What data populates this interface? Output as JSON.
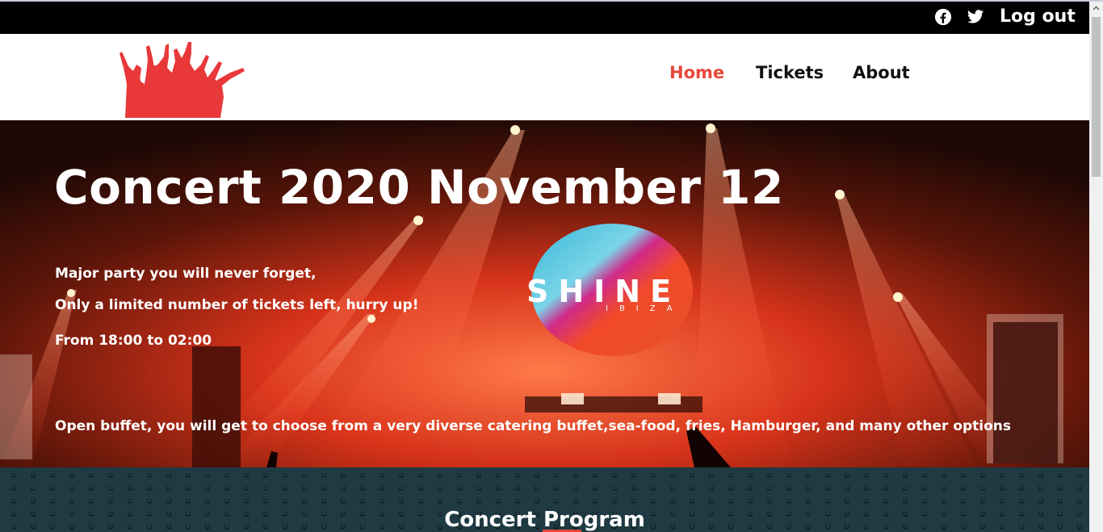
{
  "header": {
    "social": [
      {
        "name": "facebook-icon"
      },
      {
        "name": "twitter-icon"
      }
    ],
    "logout_label": "Log out"
  },
  "nav": {
    "links": [
      {
        "label": "Home",
        "active": true
      },
      {
        "label": "Tickets",
        "active": false
      },
      {
        "label": "About",
        "active": false
      }
    ]
  },
  "hero": {
    "title": "Concert 2020 November 12",
    "line1": "Major party you will never forget,",
    "line2": "Only a limited number of tickets left, hurry up!",
    "line3": "From 18:00 to 02:00",
    "line4": "Open buffet, you will get to choose from a very diverse catering buffet,sea-food, fries, Hamburger, and many other options",
    "screen_text": "SHINE",
    "screen_subtext": "IBIZA"
  },
  "program": {
    "title": "Concert Program"
  },
  "colors": {
    "accent": "#e8463a",
    "topbar": "#000000",
    "program_bg": "#1f3a43"
  }
}
